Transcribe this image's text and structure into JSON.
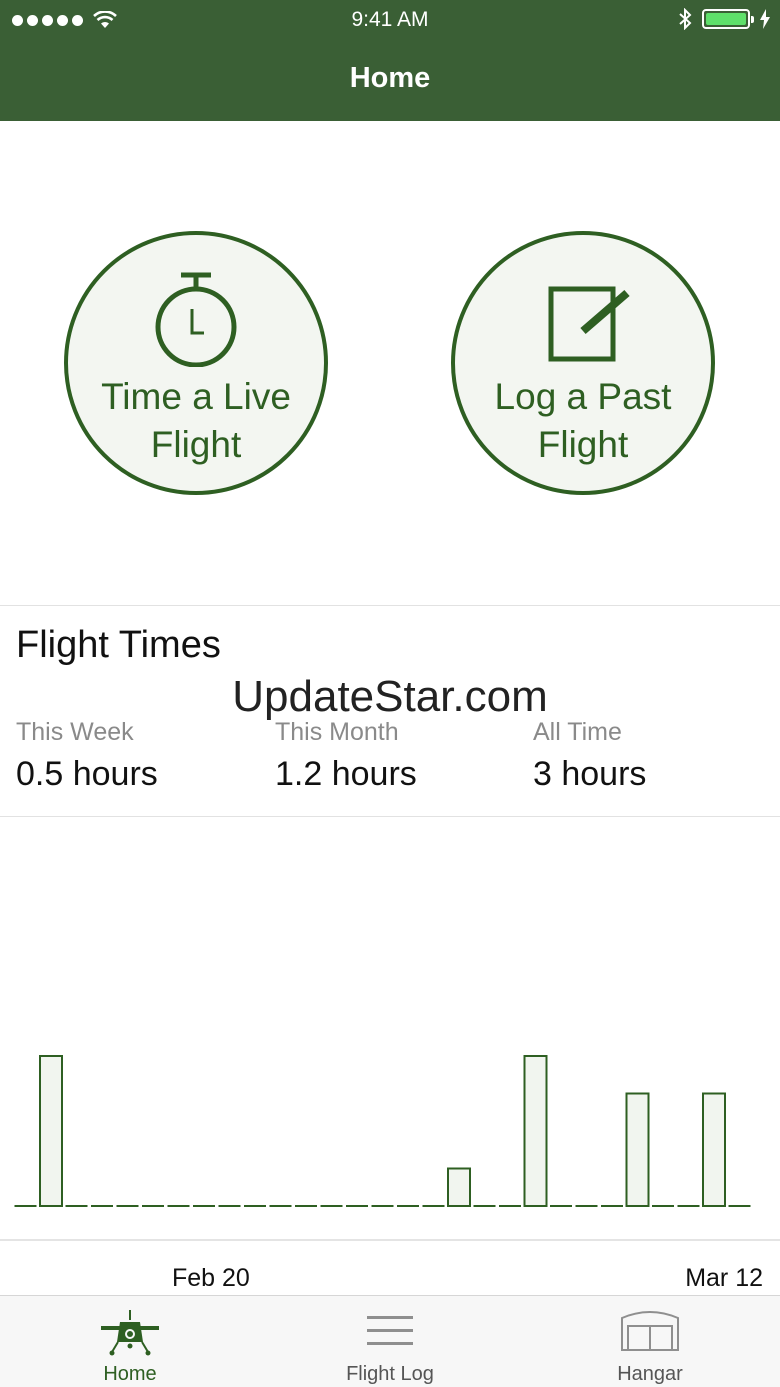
{
  "status_bar": {
    "time": "9:41 AM"
  },
  "navbar": {
    "title": "Home"
  },
  "actions": {
    "live_flight": "Time a Live\nFlight",
    "past_flight": "Log a Past\nFlight"
  },
  "flight_times": {
    "title": "Flight Times",
    "stats": [
      {
        "label": "This Week",
        "value": "0.5 hours"
      },
      {
        "label": "This Month",
        "value": "1.2 hours"
      },
      {
        "label": "All Time",
        "value": "3 hours"
      }
    ]
  },
  "watermark": "UpdateStar.com",
  "chart_data": {
    "type": "bar",
    "x_tick_labels": [
      "Feb 20",
      "Mar 12"
    ],
    "values": [
      0,
      0.4,
      0,
      0,
      0,
      0,
      0,
      0,
      0,
      0,
      0,
      0,
      0,
      0,
      0,
      0,
      0,
      0.1,
      0,
      0,
      0.4,
      0,
      0,
      0,
      0.3,
      0,
      0,
      0.3,
      0
    ],
    "ylim": [
      0,
      0.4
    ],
    "grid": false
  },
  "colors": {
    "brand": "#3a5f35",
    "accent": "#2e5f22",
    "bar_fill": "#f1f5ef",
    "inactive": "#8f8f8f"
  },
  "tabs": [
    {
      "label": "Home",
      "icon": "airplane-icon",
      "active": true
    },
    {
      "label": "Flight Log",
      "icon": "list-icon",
      "active": false
    },
    {
      "label": "Hangar",
      "icon": "hangar-icon",
      "active": false
    }
  ]
}
